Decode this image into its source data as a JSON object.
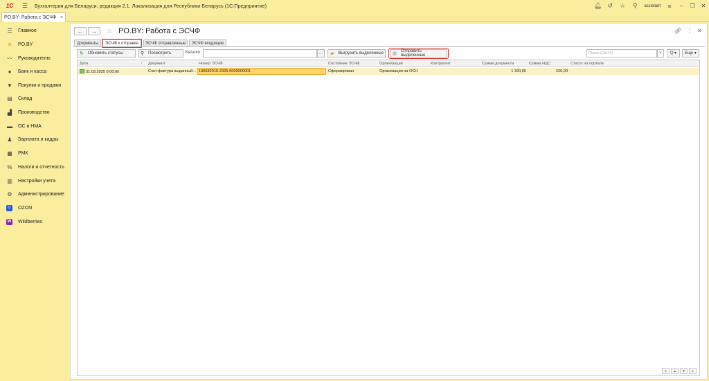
{
  "app": {
    "logo_text": "1C",
    "title": "Бухгалтерия для Беларуси, редакция 2.1. Локализация для Республики Беларусь   (1С:Предприятие)",
    "user": "assistant"
  },
  "doc_tab": {
    "label": "PO.BY: Работа с ЭСЧФ",
    "close": "×"
  },
  "sidebar": {
    "items": [
      {
        "label": "Главное",
        "icon": "menu-icon"
      },
      {
        "label": "PO.BY",
        "icon": "sun-icon"
      },
      {
        "label": "Руководителю",
        "icon": "trend-icon"
      },
      {
        "label": "Банк и касса",
        "icon": "bank-icon"
      },
      {
        "label": "Покупки и продажи",
        "icon": "cart-icon"
      },
      {
        "label": "Склад",
        "icon": "warehouse-icon"
      },
      {
        "label": "Производство",
        "icon": "factory-icon"
      },
      {
        "label": "ОС и НМА",
        "icon": "truck-icon"
      },
      {
        "label": "Зарплата и кадры",
        "icon": "person-icon"
      },
      {
        "label": "РМК",
        "icon": "register-icon"
      },
      {
        "label": "Налоги и отчетность",
        "icon": "tax-icon"
      },
      {
        "label": "Настройки учета",
        "icon": "settings-list-icon"
      },
      {
        "label": "Администрирование",
        "icon": "gear-icon"
      },
      {
        "label": "OZON",
        "icon": "ozon-icon"
      },
      {
        "label": "Wildberries",
        "icon": "wildberries-icon"
      }
    ],
    "ozon_badge": "O",
    "wb_badge": "W"
  },
  "page": {
    "title": "PO.BY: Работа с ЭСЧФ"
  },
  "form_tabs": [
    {
      "label": "Документы"
    },
    {
      "label": "ЭСЧФ к отправке"
    },
    {
      "label": "ЭСЧФ отправленные"
    },
    {
      "label": "ЭСЧФ входящие"
    }
  ],
  "toolbar": {
    "refresh_label": "Обновить статусы",
    "view_label": "Посмотреть",
    "catalog_label": "Каталог:",
    "catalog_btn": "...",
    "export_label": "Выгрузить выделенные",
    "send_label": "Отправить выделенные",
    "search_placeholder": "Поиск (Ctrl+F)",
    "search_clear": "×",
    "search_btn": "Q ▾",
    "more_label": "Еще ▾"
  },
  "table": {
    "columns": [
      "Дата",
      "↑",
      "Документ",
      "Номер ЭСЧФ",
      "Состояние ЭСЧФ",
      "Организация",
      "Контрагент",
      "Сумма документа",
      "Сумма НДС",
      "Статус на портале"
    ],
    "rows": [
      {
        "date": "31.03.2025 0:00:00",
        "document": "Счет-фактура выданный...",
        "number": "190682019-2025-0000000001",
        "state": "Сформирован",
        "organization": "Организация на ОСН",
        "counterparty": "",
        "doc_sum": "1 320,00",
        "vat_sum": "220,00",
        "portal_status": ""
      }
    ],
    "footer_buttons": [
      "≡",
      "▲",
      "▼",
      "≡"
    ]
  },
  "colors": {
    "sidebar_bg": "#fbed9e",
    "highlight_outline": "#d9302c",
    "selected_row": "#fbf1c6",
    "selected_cell": "#ffd56b"
  }
}
